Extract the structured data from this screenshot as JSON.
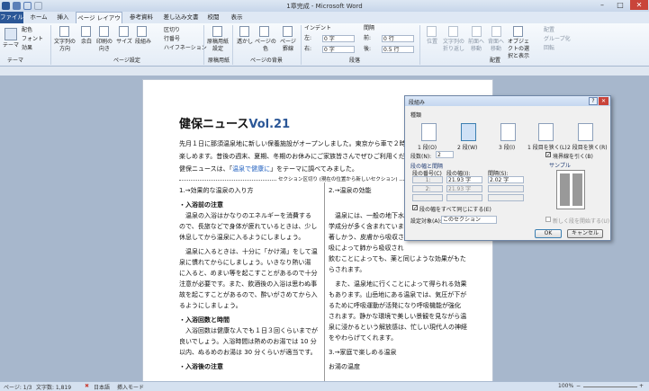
{
  "window": {
    "title": "1章完成 - Microsoft Word"
  },
  "tabs": [
    "ファイル",
    "ホーム",
    "挿入",
    "ページ レイアウト",
    "参考資料",
    "差し込み文書",
    "校閲",
    "表示"
  ],
  "ribbon": {
    "theme": {
      "button": "テーマ",
      "colors": "配色",
      "fonts": "フォント",
      "effects": "効果",
      "group": "テーマ"
    },
    "page_setup": {
      "items": [
        "文字列の方向",
        "余白",
        "印刷の向き",
        "サイズ",
        "段組み"
      ],
      "breaks": "区切り",
      "line_numbers": "行番号",
      "hyphenation": "ハイフネーション",
      "group": "ページ設定"
    },
    "manuscript": {
      "item": "原稿用紙設定",
      "group": "原稿用紙"
    },
    "background": {
      "items": [
        "透かし",
        "ページの色",
        "ページ罫線"
      ],
      "group": "ページの背景"
    },
    "paragraph": {
      "indent_label": "インデント",
      "left": "左:",
      "left_val": "0 字",
      "right": "右:",
      "right_val": "0 字",
      "spacing_label": "間隔",
      "before": "前:",
      "before_val": "0 行",
      "after": "後:",
      "after_val": "0.5 行",
      "group": "段落"
    },
    "arrange": {
      "items": [
        "位置",
        "文字列の折り返し",
        "前面へ移動",
        "背面へ移動",
        "オブジェクトの選択と表示"
      ],
      "align": "配置",
      "group_btn": "グループ化",
      "rotate": "回転",
      "group": "配置"
    }
  },
  "doc": {
    "title": "健保ニュース",
    "volume": "Vol.21",
    "intro": [
      "先月１日に那須温泉地に新しい保養施設がオープンしました。東京から車で２時",
      "楽しめます。昔後の週末、夏期、冬期のお休みにご家族皆さんでぜひご利用くだ"
    ],
    "intro3_pre": "健保ニュースは、「",
    "intro3_em": "温泉で健康に",
    "intro3_post": "」をテーマに調べてみました。",
    "section_break": "セクション区切り (現在の位置から新しいセクション)",
    "left_col": [
      {
        "t": "1.→効果的な温泉の入り方",
        "b": false
      },
      {
        "t": "・入浴前の注意",
        "b": true
      },
      {
        "t": "　温泉の入浴はかなりのエネルギーを消費する",
        "b": false
      },
      {
        "t": "ので、長旅などで身体が疲れているときは、少し",
        "b": false
      },
      {
        "t": "休息してから温泉に入るようにしましょう。",
        "b": false
      },
      {
        "t": "　温泉に入るときは、十分に「かけ湯」をして温",
        "b": false
      },
      {
        "t": "泉に慣れてからにしましょう。いきなり熱い湯",
        "b": false
      },
      {
        "t": "に入ると、めまい等を起こすことがあるので十分",
        "b": false
      },
      {
        "t": "注意が必要です。また、飲酒後の入浴は思わぬ事",
        "b": false
      },
      {
        "t": "故を起こすことがあるので、酔いがさめてから入",
        "b": false
      },
      {
        "t": "るようにしましょう。",
        "b": false
      },
      {
        "t": "・入浴回数と時間",
        "b": true
      },
      {
        "t": "　入浴回数は健康な人でも１日３回くらいまでが",
        "b": false
      },
      {
        "t": "良いでしょう。入浴時間は熱めのお湯では 10 分",
        "b": false
      },
      {
        "t": "以内、ぬるめのお湯は 30 分くらいが適当です。",
        "b": false
      },
      {
        "t": "・入浴後の注意",
        "b": true
      }
    ],
    "right_col": [
      "2.→温泉の効能",
      "　温泉には、一般の地下水",
      "学成分が多く含まれていま",
      "著しかう、皮膚から吸収さ",
      "吸によって肺から吸収され",
      "飲むことによっても、薬と同じような効果がもた",
      "らされます。",
      "　また、温泉地に行くことによって得られる効果",
      "もあります。山岳地にある温泉では、気圧が下が",
      "るために呼吸運動が活発になり呼吸機能が強化",
      "されます。静かな環境で美しい景観を見ながら温",
      "泉に浸かるという解放感は、忙しい現代人の神経",
      "をやわらげてくれます。",
      "3.→家庭で楽しめる温泉",
      "お湯の温度"
    ]
  },
  "dialog": {
    "title": "段組み",
    "presets_label": "種類",
    "presets": [
      "1 段(O)",
      "2 段(W)",
      "3 段(I)",
      "1 段目を狭く(L)",
      "2 段目を狭く(R)"
    ],
    "num_cols_label": "段数(N):",
    "num_cols": "2",
    "border_label": "境界線を引く(B)",
    "width_spacing_label": "段の幅と間隔",
    "col_no_label": "段の番号(C)",
    "width_label": "段の幅(I):",
    "spacing_label": "間隔(S):",
    "row1": {
      "no": "1:",
      "width": "21.93 字",
      "spacing": "2.02 字"
    },
    "row2": {
      "no": "2:",
      "width": "21.93 字",
      "spacing": ""
    },
    "equal_width": "段の幅をすべて同じにする(E)",
    "apply_label": "設定対象(A):",
    "apply_value": "このセクション",
    "preview_label": "サンプル",
    "new_col": "新しく段を開始する(U)",
    "ok": "OK",
    "cancel": "キャンセル"
  },
  "status": {
    "page": "ページ: 1/3",
    "words": "文字数: 1,819",
    "lang": "日本語",
    "mode": "挿入モード",
    "zoom": "100%"
  },
  "colors": {
    "file_tab": "#2b5797",
    "accent": "#3c7fb1",
    "dialog_bg": "#f0f0f0"
  }
}
